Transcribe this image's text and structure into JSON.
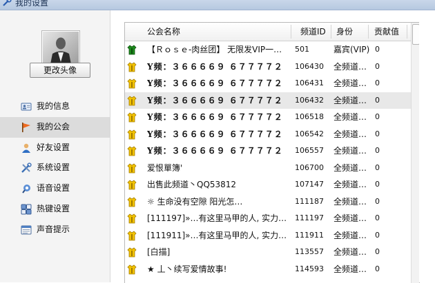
{
  "window": {
    "title": "我的设置",
    "icon": "wrench-icon"
  },
  "profile": {
    "avatar": "user-photo",
    "change_avatar_label": "更改头像"
  },
  "nav": {
    "items": [
      {
        "label": "我的信息",
        "icon": "id-card-icon",
        "active": false
      },
      {
        "label": "我的公会",
        "icon": "flag-icon",
        "active": true
      },
      {
        "label": "好友设置",
        "icon": "friend-icon",
        "active": false
      },
      {
        "label": "系统设置",
        "icon": "tools-icon",
        "active": false
      },
      {
        "label": "语音设置",
        "icon": "voice-icon",
        "active": false
      },
      {
        "label": "热键设置",
        "icon": "hotkey-icon",
        "active": false
      },
      {
        "label": "声音提示",
        "icon": "sound-icon",
        "active": false
      }
    ]
  },
  "table": {
    "headers": {
      "name": "公会名称",
      "channel_id": "频道ID",
      "role": "身份",
      "contribution": "贡献值"
    },
    "rows": [
      {
        "icon": "guild-green-icon",
        "name": "【Ｒｏｓｅ-肉丝团】  无限发VIP一…",
        "id": "501",
        "role": "嘉宾(VIP)",
        "contrib": "0",
        "selected": false
      },
      {
        "icon": "guild-yellow-icon",
        "name": "Y频：３６６６６９   ６７７７７２",
        "id": "106430",
        "role": "全频道…",
        "contrib": "0",
        "selected": false
      },
      {
        "icon": "guild-yellow-icon",
        "name": "Y频：３６６６６９   ６７７７７２",
        "id": "106431",
        "role": "全频道…",
        "contrib": "0",
        "selected": false
      },
      {
        "icon": "guild-yellow-icon",
        "name": "Y频：３６６６６９   ６７７７７２",
        "id": "106432",
        "role": "全频道…",
        "contrib": "0",
        "selected": true
      },
      {
        "icon": "guild-yellow-icon",
        "name": "Y频：３６６６６９   ６７７７７２",
        "id": "106518",
        "role": "全频道…",
        "contrib": "0",
        "selected": false
      },
      {
        "icon": "guild-yellow-icon",
        "name": "Y频：３６６６６９   ６７７７７２",
        "id": "106542",
        "role": "全频道…",
        "contrib": "0",
        "selected": false
      },
      {
        "icon": "guild-yellow-icon",
        "name": "Y频：３６６６６９   ６７７７７２",
        "id": "106557",
        "role": "全频道…",
        "contrib": "0",
        "selected": false
      },
      {
        "icon": "guild-yellow-icon",
        "name": "爱恨單簿'",
        "id": "106700",
        "role": "全频道…",
        "contrib": "0",
        "selected": false
      },
      {
        "icon": "guild-yellow-icon",
        "name": "出售此频道丶QQ53812",
        "id": "107147",
        "role": "全频道…",
        "contrib": "0",
        "selected": false
      },
      {
        "icon": "guild-yellow-icon",
        "name": "     ☼     生命没有空隙 阳光怎…",
        "id": "111187",
        "role": "全频道…",
        "contrib": "0",
        "selected": false
      },
      {
        "icon": "guild-yellow-icon",
        "name": "[111197]»…有这里马甲的人, 实力…",
        "id": "111197",
        "role": "全频道…",
        "contrib": "0",
        "selected": false
      },
      {
        "icon": "guild-yellow-icon",
        "name": "[111911]»…有这里马甲的人, 实力…",
        "id": "111911",
        "role": "全频道…",
        "contrib": "0",
        "selected": false
      },
      {
        "icon": "guild-yellow-icon",
        "name": "[白描]",
        "id": "113557",
        "role": "全频道…",
        "contrib": "0",
        "selected": false
      },
      {
        "icon": "guild-yellow-icon",
        "name": "  ★ 丄丶续写爱情故事!",
        "id": "114593",
        "role": "全频道…",
        "contrib": "0",
        "selected": false
      }
    ]
  },
  "colors": {
    "selected_row": "#e8e8e8",
    "active_nav": "#dcdcdc",
    "guild_yellow": "#f2c200",
    "guild_green": "#1e8a1e"
  }
}
